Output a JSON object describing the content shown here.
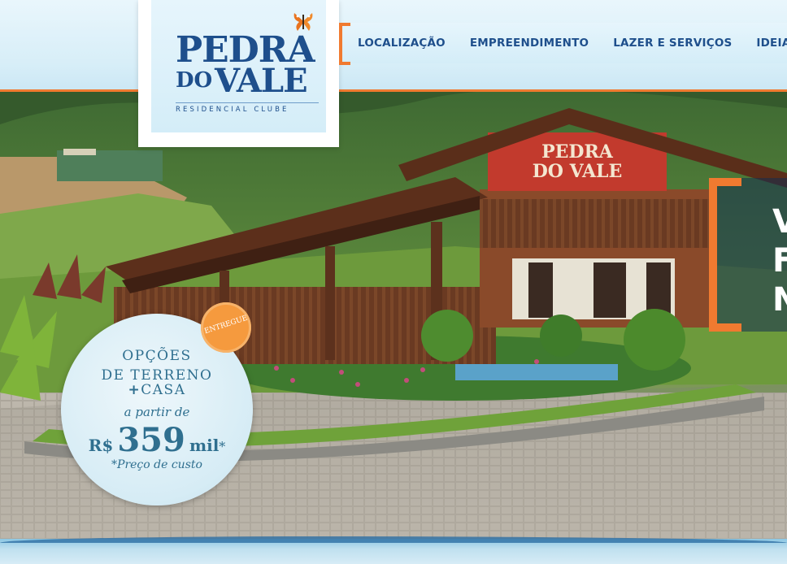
{
  "brand": {
    "logo_line1": "PEDRA",
    "logo_line2_small": "DO",
    "logo_line2": "VALE",
    "logo_subtitle": "RESIDENCIAL CLUBE"
  },
  "nav": {
    "items": [
      {
        "label": "LOCALIZAÇÃO"
      },
      {
        "label": "EMPREENDIMENTO"
      },
      {
        "label": "LAZER E SERVIÇOS"
      },
      {
        "label": "IDEIAS DE"
      }
    ]
  },
  "hero": {
    "sign_line1": "PEDRA",
    "sign_line2": "DO VALE"
  },
  "teaser": {
    "lines": [
      "V",
      "F",
      "N"
    ]
  },
  "badge": {
    "line1": "OPÇÕES",
    "line2": "DE TERRENO",
    "line3_plus": "+",
    "line3": "CASA",
    "line4": "a partir de",
    "currency": "R$",
    "amount": "359",
    "unit": "mil",
    "asterisk": "*",
    "footnote": "*Preço de custo",
    "seal": "ENTREGUE"
  },
  "colors": {
    "brand_blue": "#1e4f8c",
    "accent_orange": "#f07a30"
  }
}
